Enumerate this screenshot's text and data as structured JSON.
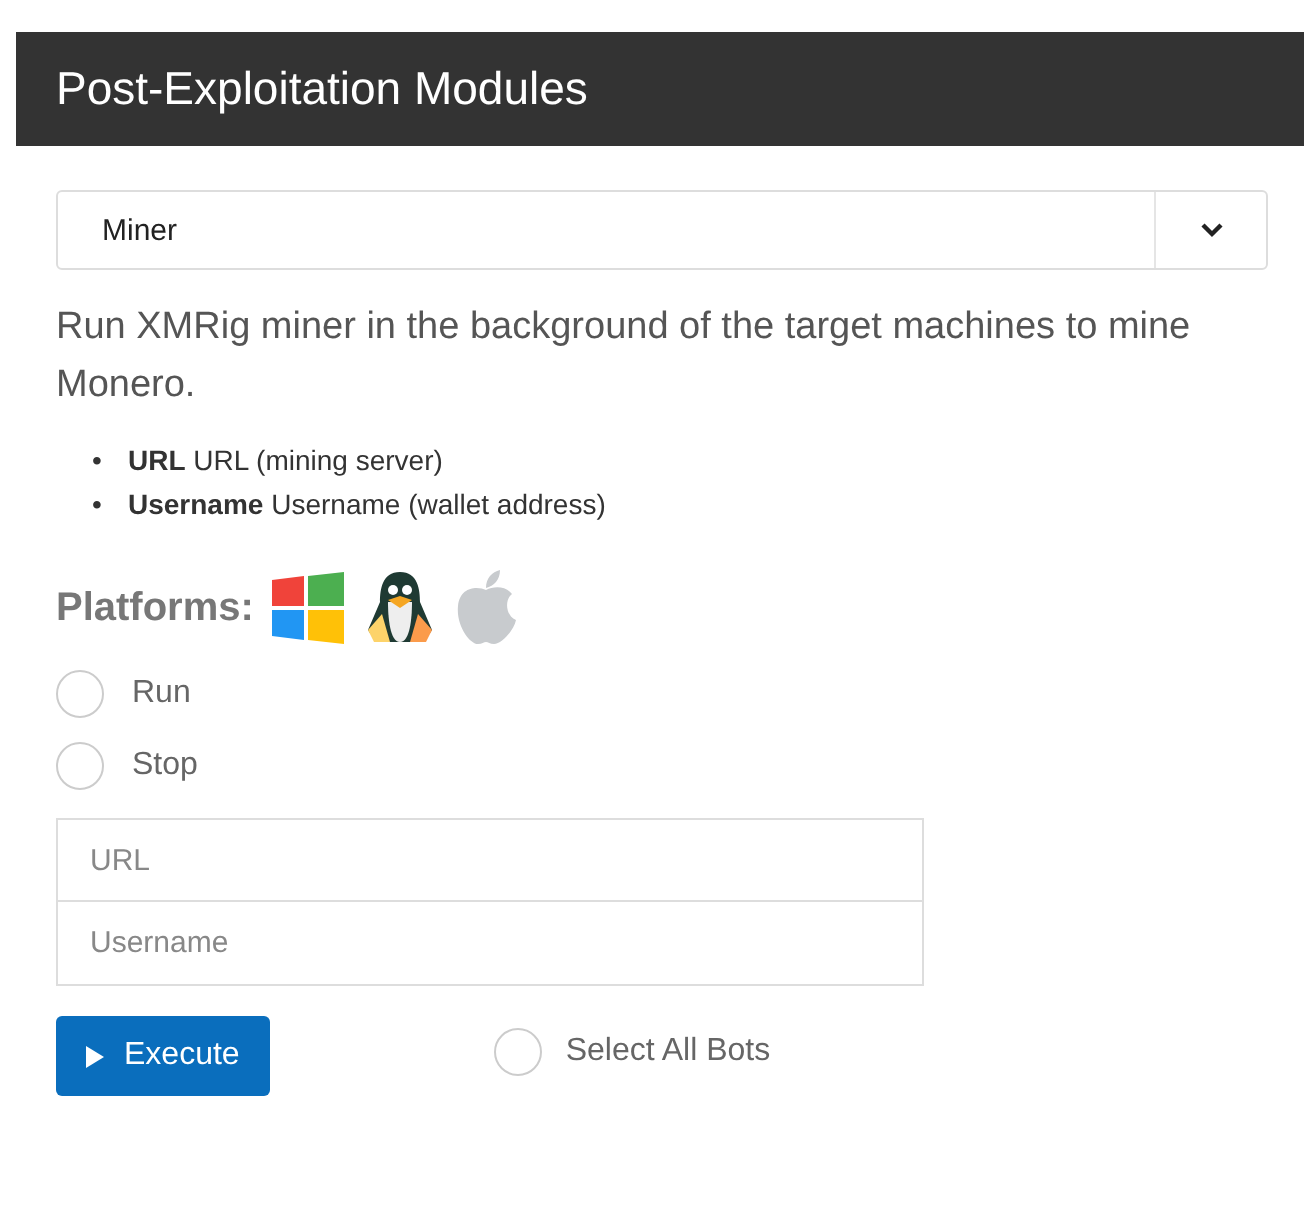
{
  "header": {
    "title": "Post-Exploitation Modules"
  },
  "module_select": {
    "value": "Miner"
  },
  "description": "Run XMRig miner in the background of the target machines to mine Monero.",
  "parameters": [
    {
      "bullet": "•",
      "name": "URL",
      "text": "URL (mining server)"
    },
    {
      "bullet": "•",
      "name": "Username",
      "text": "Username (wallet address)"
    }
  ],
  "platforms": {
    "label": "Platforms:",
    "icons": [
      {
        "kind": "windows"
      },
      {
        "kind": "linux"
      },
      {
        "kind": "apple"
      }
    ]
  },
  "actions": [
    {
      "label": "Run",
      "selected": false
    },
    {
      "label": "Stop",
      "selected": false
    }
  ],
  "fields": [
    {
      "placeholder": "URL"
    },
    {
      "placeholder": "Username"
    }
  ],
  "execute_button": {
    "label": "Execute"
  },
  "select_all": {
    "label": "Select All Bots",
    "checked": false
  }
}
